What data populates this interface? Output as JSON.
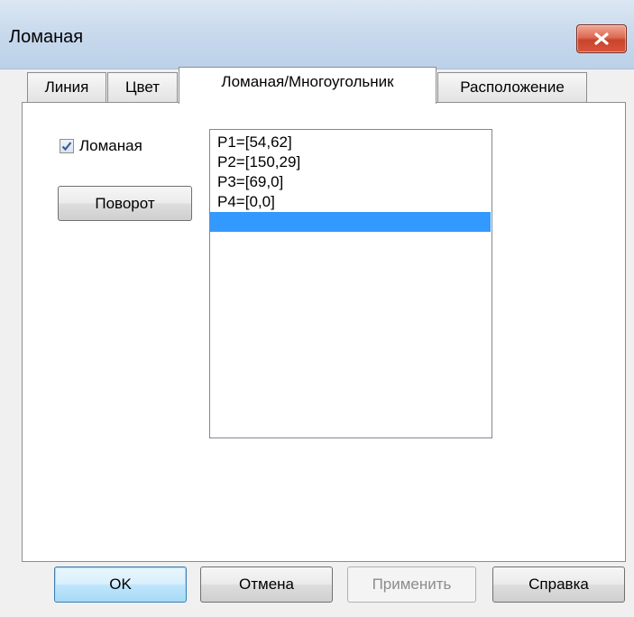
{
  "window": {
    "title": "Ломаная",
    "close_icon": "close-icon"
  },
  "tabs": [
    {
      "label": "Линия",
      "active": false
    },
    {
      "label": "Цвет",
      "active": false
    },
    {
      "label": "Ломаная/Многоугольник",
      "active": true
    },
    {
      "label": "Расположение",
      "active": false
    }
  ],
  "panel": {
    "checkbox": {
      "label": "Ломаная",
      "checked": true
    },
    "rotate_button": "Поворот",
    "points": [
      "P1=[54,62]",
      "P2=[150,29]",
      "P3=[69,0]",
      "P4=[0,0]",
      ""
    ],
    "selected_index": 4
  },
  "footer": {
    "ok": "OK",
    "cancel": "Отмена",
    "apply": "Применить",
    "help": "Справка"
  },
  "colors": {
    "selection": "#3399ff",
    "close_button": "#c8432a"
  }
}
